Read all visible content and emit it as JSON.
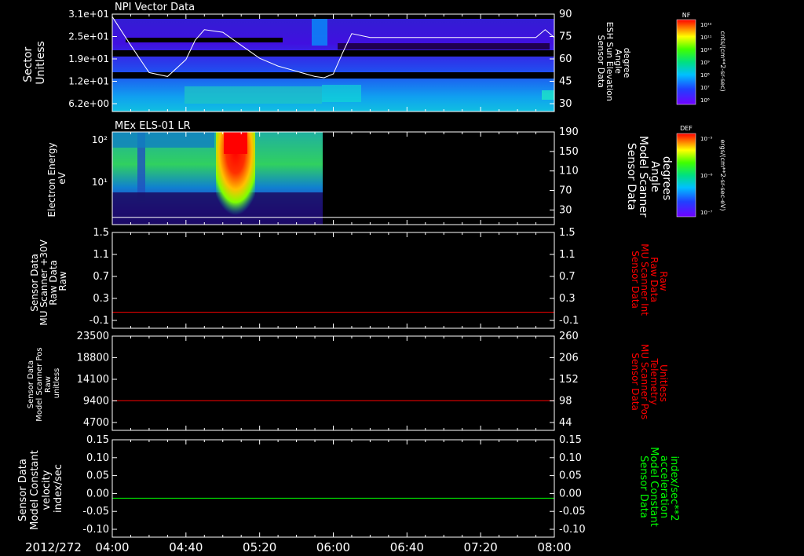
{
  "date_label": "2012/272",
  "time_ticks": [
    "04:00",
    "04:40",
    "05:20",
    "06:00",
    "06:40",
    "07:20",
    "08:00"
  ],
  "colors": {
    "background": "#000000",
    "axes": "#ffffff",
    "red_trace": "#ff0000",
    "green_trace": "#00ff00"
  },
  "colorbars": [
    {
      "label": "NF",
      "unit": "cnts/(cm**2-sr-sec)",
      "ticks": [
        "10¹²",
        "10¹¹",
        "10¹⁰",
        "10⁹",
        "10⁸",
        "10⁷",
        "10⁶"
      ]
    },
    {
      "label": "DEF",
      "unit": "ergs/(cm**2-sr-sec-eV)",
      "ticks": [
        "10⁻⁵",
        "10⁻⁶",
        "10⁻⁷"
      ]
    }
  ],
  "chart_data": [
    {
      "type": "heatmap",
      "title": "NPI Vector Data",
      "ylabel": [
        "Sector",
        "Unitless"
      ],
      "y_ticks": [
        "3.1e+01",
        "2.5e+01",
        "1.9e+01",
        "1.2e+01",
        "6.2e+00"
      ],
      "ylim": [
        0,
        31
      ],
      "overlay": {
        "type": "line",
        "ylabel": [
          "Sensor Data",
          "ESH Sun Elevation",
          "Angle",
          "degree"
        ],
        "ylim": [
          15,
          90
        ],
        "y_ticks": [
          30,
          45,
          60,
          75,
          90
        ],
        "x": [
          "04:00",
          "04:10",
          "04:20",
          "04:30",
          "04:40",
          "04:45",
          "04:50",
          "05:00",
          "05:10",
          "05:20",
          "05:30",
          "05:40",
          "05:50",
          "05:55",
          "06:00",
          "06:05",
          "06:10",
          "06:20",
          "06:40",
          "07:00",
          "07:20",
          "07:40",
          "07:50",
          "07:55",
          "08:00"
        ],
        "y": [
          88,
          66,
          45,
          42,
          55,
          70,
          78,
          76,
          66,
          56,
          50,
          46,
          42,
          41,
          44,
          60,
          75,
          72,
          72,
          72,
          72,
          72,
          72,
          78,
          72
        ]
      }
    },
    {
      "type": "heatmap",
      "title": "MEx ELS-01 LR",
      "ylabel": [
        "Electron Energy",
        "eV"
      ],
      "y_ticks": [
        "10²",
        "10¹"
      ],
      "y_scale": "log",
      "overlay": {
        "type": "line",
        "ylabel": [
          "Sensor Data",
          "Model Scanner",
          "Angle",
          "degrees"
        ],
        "ylim": [
          0,
          190
        ],
        "y_ticks": [
          30,
          70,
          110,
          150,
          190
        ],
        "x": [
          "04:00",
          "08:00"
        ],
        "y": [
          15,
          15
        ]
      }
    },
    {
      "type": "line",
      "ylabel": [
        "Sensor Data",
        "MU Scanner +30V",
        "Raw Data",
        "Raw"
      ],
      "ylim": [
        -0.3,
        1.5
      ],
      "y_ticks": [
        "1.5",
        "1.1",
        "0.7",
        "0.3",
        "-0.1"
      ],
      "right_ylabel": [
        "Sensor Data",
        "MU Scanner Int",
        "Raw Data",
        "Raw"
      ],
      "right_ticks": [
        "1.5",
        "1.1",
        "0.7",
        "0.3",
        "-0.1"
      ],
      "x": [
        "04:00",
        "08:00"
      ],
      "y": [
        0,
        0
      ]
    },
    {
      "type": "line",
      "ylabel": [
        "Sensor Data",
        "Model Scanner Pos",
        "Raw",
        "unitless"
      ],
      "ylim": [
        0,
        23500
      ],
      "y_ticks": [
        "23500",
        "18800",
        "14100",
        "9400",
        "4700"
      ],
      "right_ylabel": [
        "Sensor Data",
        "MU Scanner Pos",
        "Telemetry",
        "Unitless"
      ],
      "right_ticks": [
        "260",
        "206",
        "152",
        "98",
        "44"
      ],
      "x": [
        "04:00",
        "08:00"
      ],
      "y": [
        7400,
        7400
      ]
    },
    {
      "type": "line",
      "ylabel": [
        "Sensor Data",
        "Model Constant",
        "velocity",
        "index/sec"
      ],
      "ylim": [
        -0.1,
        0.15
      ],
      "y_ticks": [
        "0.15",
        "0.10",
        "0.05",
        "0.00",
        "-0.05",
        "-0.10"
      ],
      "right_ylabel": [
        "Sensor Data",
        "Model Constant",
        "acceleration",
        "index/sec**2"
      ],
      "right_ticks": [
        "0.15",
        "0.10",
        "0.05",
        "0.00",
        "-0.05",
        "-0.10"
      ],
      "x": [
        "04:00",
        "08:00"
      ],
      "y": [
        0,
        0
      ]
    }
  ]
}
